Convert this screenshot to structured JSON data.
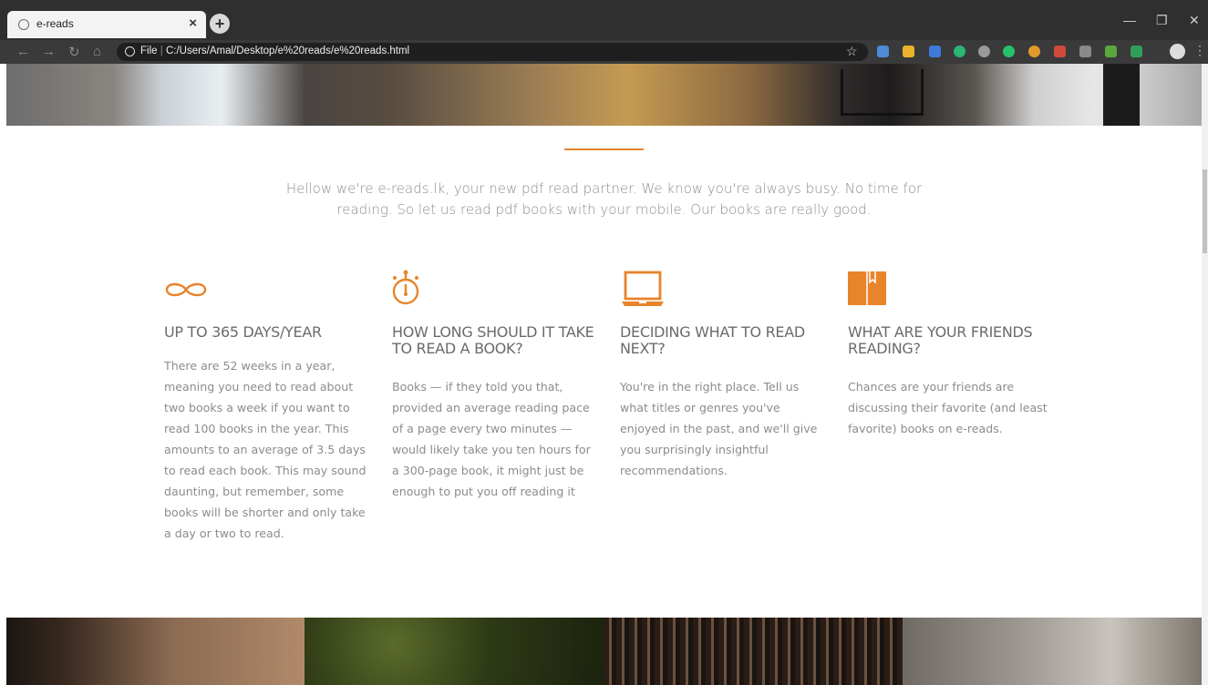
{
  "browser": {
    "tab_title": "e-reads",
    "tab_close": "×",
    "new_tab": "+",
    "url_prefix": "File",
    "url": "C:/Users/Amal/Desktop/e%20reads/e%20reads.html",
    "window_controls": [
      "—",
      "❐",
      "✕"
    ]
  },
  "intro": "Hellow we're e-reads.lk, your new pdf read partner. We know you're always busy. No time for reading. So let us read pdf books with your mobile. Our books are really good.",
  "accent_color": "#e8842a",
  "features": [
    {
      "icon": "infinity-icon",
      "title": "UP TO 365 DAYS/YEAR",
      "text": "There are 52 weeks in a year, meaning you need to read about two books a week if you want to read 100 books in the year. This amounts to an average of 3.5 days to read each book. This may sound daunting, but remember, some books will be shorter and only take a day or two to read."
    },
    {
      "icon": "stopwatch-icon",
      "title": "HOW LONG SHOULD IT TAKE TO READ A BOOK?",
      "text": "Books — if they told you that, provided an average reading pace of a page every two minutes — would likely take you ten hours for a 300-page book, it might just be enough to put you off reading it"
    },
    {
      "icon": "laptop-icon",
      "title": "DECIDING WHAT TO READ NEXT?",
      "text": "You're in the right place. Tell us what titles or genres you've enjoyed in the past, and we'll give you surprisingly insightful recommendations."
    },
    {
      "icon": "book-bookmark-icon",
      "title": "WHAT ARE YOUR FRIENDS READING?",
      "text": "Chances are your friends are discussing their favorite (and least favorite) books on e-reads."
    }
  ]
}
